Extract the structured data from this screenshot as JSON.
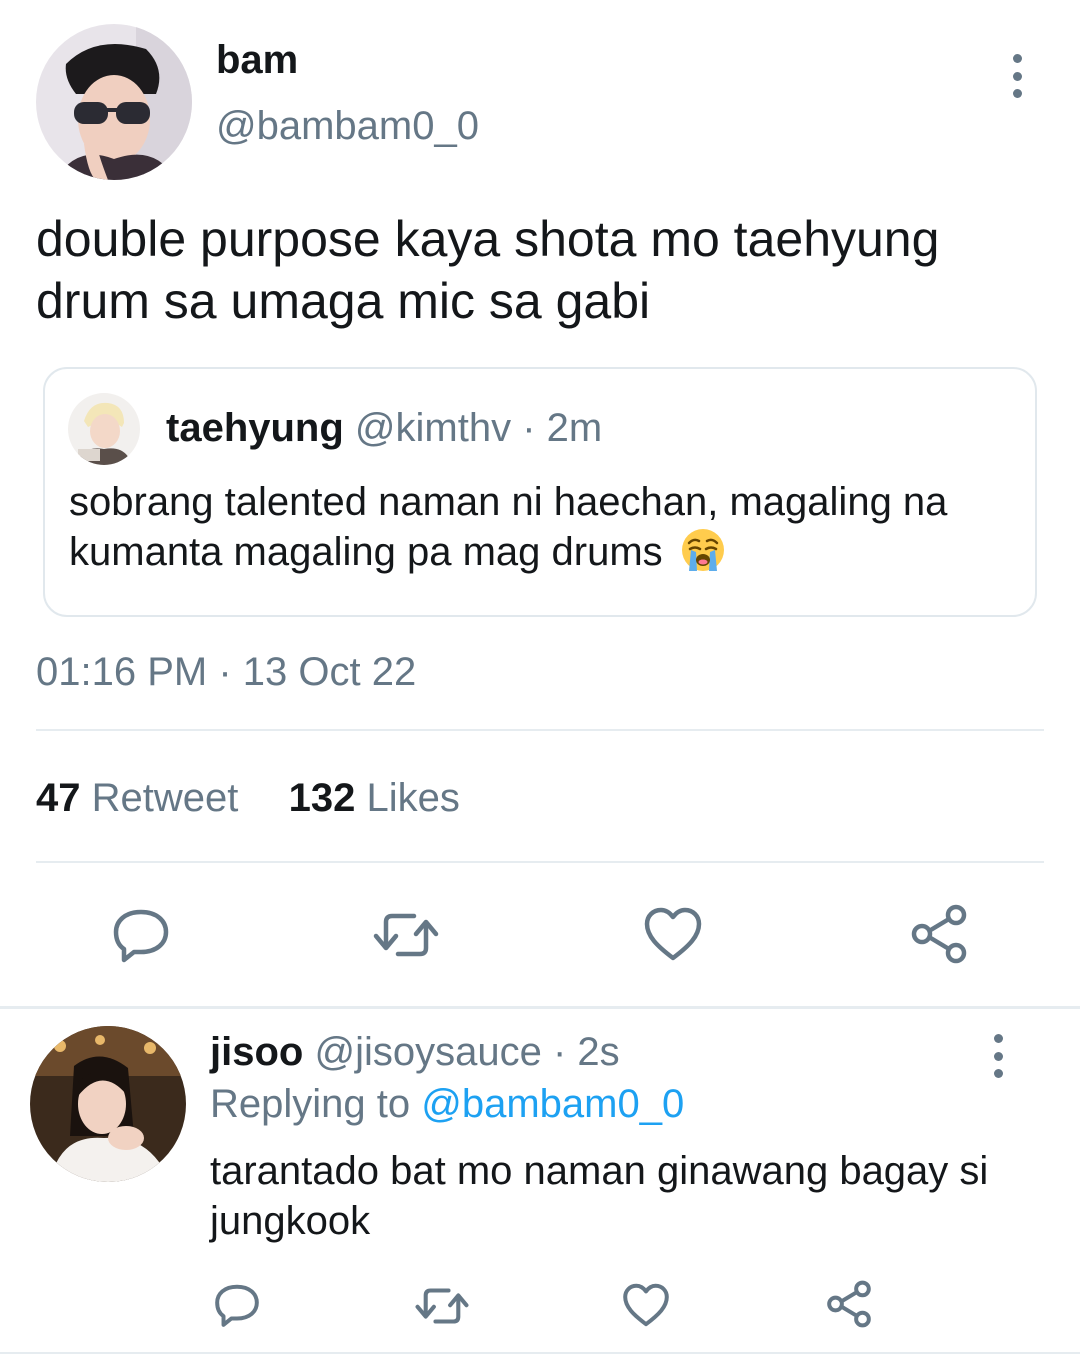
{
  "main_tweet": {
    "author": {
      "name": "bam",
      "handle": "@bambam0_0",
      "avatar_icon": "profile-photo"
    },
    "text": "double purpose kaya shota mo taehyung drum sa umaga mic sa gabi",
    "quoted_tweet": {
      "name": "taehyung",
      "handle": "@kimthv",
      "time": "2m",
      "text": "sobrang talented naman ni haechan, magaling na kumanta magaling pa mag drums",
      "emoji_icon": "loudly-crying-face"
    },
    "timestamp": "01:16 PM · 13 Oct 22",
    "stats": {
      "retweet_count": "47",
      "retweet_label": "Retweet",
      "likes_count": "132",
      "likes_label": "Likes"
    },
    "actions": [
      "reply-icon",
      "retweet-icon",
      "like-icon",
      "share-icon"
    ]
  },
  "reply": {
    "name": "jisoo",
    "handle": "@jisoysauce",
    "time": "2s",
    "replying_prefix": "Replying to",
    "replying_to": "@bambam0_0",
    "text": "tarantado bat mo naman ginawang bagay si jungkook",
    "actions": [
      "reply-icon",
      "retweet-icon",
      "like-icon",
      "share-icon"
    ]
  },
  "colors": {
    "text_primary": "#14171a",
    "text_secondary": "#657786",
    "accent": "#1da1f2",
    "divider": "#e6ecf0",
    "icon": "#657786"
  }
}
